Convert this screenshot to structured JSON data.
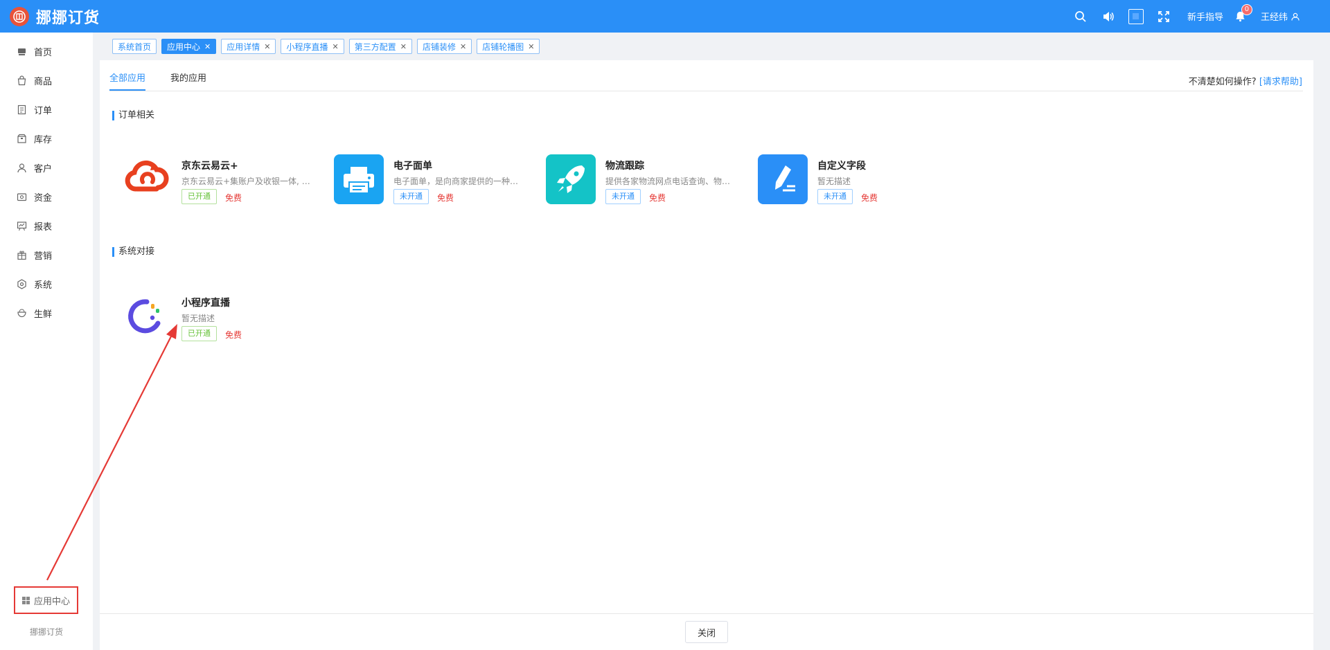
{
  "topbar": {
    "brand": "挪挪订货",
    "guide": "新手指导",
    "notify_count": "0",
    "user": "王经纬"
  },
  "sidebar": {
    "items": [
      {
        "label": "首页",
        "icon": "home-icon"
      },
      {
        "label": "商品",
        "icon": "bag-icon"
      },
      {
        "label": "订单",
        "icon": "order-icon"
      },
      {
        "label": "库存",
        "icon": "box-icon"
      },
      {
        "label": "客户",
        "icon": "user-icon"
      },
      {
        "label": "资金",
        "icon": "wallet-icon"
      },
      {
        "label": "报表",
        "icon": "chart-icon"
      },
      {
        "label": "营销",
        "icon": "gift-icon"
      },
      {
        "label": "系统",
        "icon": "gear-icon"
      },
      {
        "label": "生鲜",
        "icon": "bowl-icon"
      }
    ],
    "app_center": "应用中心",
    "footer": "挪挪订货"
  },
  "tabs": [
    {
      "label": "系统首页",
      "closable": false,
      "active": false
    },
    {
      "label": "应用中心",
      "closable": true,
      "active": true
    },
    {
      "label": "应用详情",
      "closable": true,
      "active": false
    },
    {
      "label": "小程序直播",
      "closable": true,
      "active": false
    },
    {
      "label": "第三方配置",
      "closable": true,
      "active": false
    },
    {
      "label": "店铺装修",
      "closable": true,
      "active": false
    },
    {
      "label": "店铺轮播图",
      "closable": true,
      "active": false
    }
  ],
  "subtabs": {
    "all": "全部应用",
    "mine": "我的应用"
  },
  "help": {
    "text": "不清楚如何操作?",
    "link": "[请求帮助]"
  },
  "sections": {
    "orders": {
      "title": "订单相关",
      "apps": [
        {
          "name": "京东云易云+",
          "desc": "京东云易云+集账户及收银一体, 支持多种支付方式",
          "status": "已开通",
          "price": "免费"
        },
        {
          "name": "电子面单",
          "desc": "电子面单，是向商家提供的一种通过热敏纸打印",
          "status": "未开通",
          "price": "免费"
        },
        {
          "name": "物流跟踪",
          "desc": "提供各家物流网点电话查询、物流轨迹查询",
          "status": "未开通",
          "price": "免费"
        },
        {
          "name": "自定义字段",
          "desc": "暂无描述",
          "status": "未开通",
          "price": "免费"
        }
      ]
    },
    "system": {
      "title": "系统对接",
      "apps": [
        {
          "name": "小程序直播",
          "desc": "暂无描述",
          "status": "已开通",
          "price": "免费"
        }
      ]
    }
  },
  "footer": {
    "close": "关闭"
  },
  "colors": {
    "primary": "#2a8ff7",
    "annotation": "#e53935"
  }
}
